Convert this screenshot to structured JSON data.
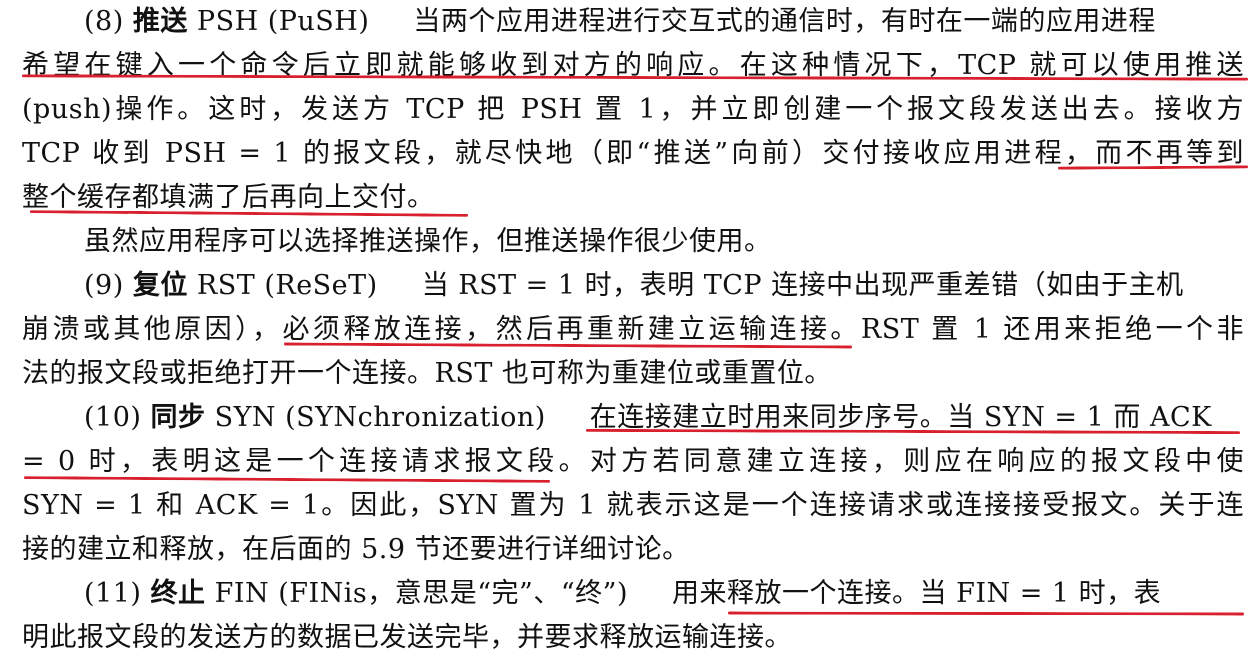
{
  "document": {
    "lines": [
      {
        "head": "(8) ",
        "bold": "推送",
        "tail": " PSH (PuSH)",
        "rest": "当两个应用进程进行交互式的通信时，有时在一端的应用进程"
      },
      {
        "text": "希望在键入一个命令后立即就能够收到对方的响应。在这种情况下，TCP 就可以使用推送"
      },
      {
        "text": "(push)操作。这时，发送方 TCP 把 PSH 置 1，并立即创建一个报文段发送出去。接收方"
      },
      {
        "text": "TCP 收到 PSH = 1 的报文段，就尽快地（即“推送”向前）交付接收应用进程，而不再等到"
      },
      {
        "text": "整个缓存都填满了后再向上交付。"
      },
      {
        "text": "虽然应用程序可以选择推送操作，但推送操作很少使用。"
      },
      {
        "head": "(9) ",
        "bold": "复位",
        "tail": " RST (ReSeT)",
        "rest": "当 RST = 1 时，表明 TCP 连接中出现严重差错（如由于主机"
      },
      {
        "text": "崩溃或其他原因），必须释放连接，然后再重新建立运输连接。RST 置 1 还用来拒绝一个非"
      },
      {
        "text": "法的报文段或拒绝打开一个连接。RST 也可称为重建位或重置位。"
      },
      {
        "head": "(10) ",
        "bold": "同步",
        "tail": " SYN (SYNchronization)",
        "rest": "在连接建立时用来同步序号。当 SYN = 1 而 ACK"
      },
      {
        "text": "= 0 时，表明这是一个连接请求报文段。对方若同意建立连接，则应在响应的报文段中使"
      },
      {
        "text": "SYN = 1 和 ACK = 1。因此，SYN 置为 1 就表示这是一个连接请求或连接接受报文。关于连"
      },
      {
        "text": "接的建立和释放，在后面的 5.9 节还要进行详细讨论。"
      },
      {
        "head": "(11) ",
        "bold": "终止",
        "tail": " FIN (FINis，意思是“完”、“终”)",
        "rest": "用来释放一个连接。当 FIN = 1 时，表"
      },
      {
        "text": "明此报文段的发送方的数据已发送完毕，并要求释放运输连接。"
      }
    ]
  },
  "annotation_color": "#d8202e"
}
